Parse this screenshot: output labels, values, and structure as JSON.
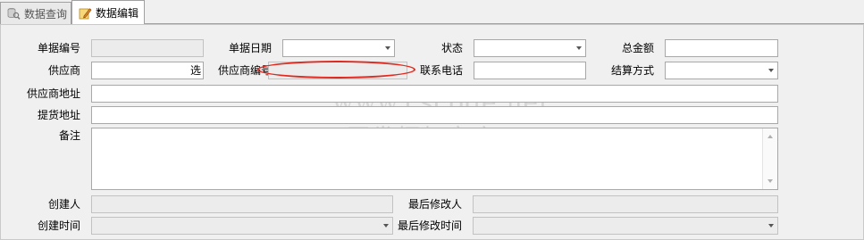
{
  "tabs": [
    {
      "label": "数据查询",
      "icon": "database-query-icon",
      "active": false
    },
    {
      "label": "数据编辑",
      "icon": "edit-pencil-icon",
      "active": true
    }
  ],
  "form": {
    "doc_no": {
      "label": "单据编号",
      "value": ""
    },
    "doc_date": {
      "label": "单据日期",
      "value": ""
    },
    "status": {
      "label": "状态",
      "value": ""
    },
    "total": {
      "label": "总金额",
      "value": ""
    },
    "supplier": {
      "label": "供应商",
      "value": "",
      "pick_label": "选"
    },
    "supplier_code": {
      "label": "供应商编号",
      "value": ""
    },
    "phone": {
      "label": "联系电话",
      "value": ""
    },
    "settle": {
      "label": "结算方式",
      "value": ""
    },
    "supplier_addr": {
      "label": "供应商地址",
      "value": ""
    },
    "pickup_addr": {
      "label": "提货地址",
      "value": ""
    },
    "remark": {
      "label": "备注",
      "value": ""
    },
    "creator": {
      "label": "创建人",
      "value": ""
    },
    "modifier": {
      "label": "最后修改人",
      "value": ""
    },
    "created_at": {
      "label": "创建时间",
      "value": ""
    },
    "modified_at": {
      "label": "最后修改时间",
      "value": ""
    }
  },
  "watermark": {
    "line1": "www.cscode.net",
    "line2": "开发框架文库"
  },
  "colors": {
    "annotation": "#e02a20",
    "panel_bg": "#f0f0f0",
    "readonly_bg": "#ececec"
  }
}
